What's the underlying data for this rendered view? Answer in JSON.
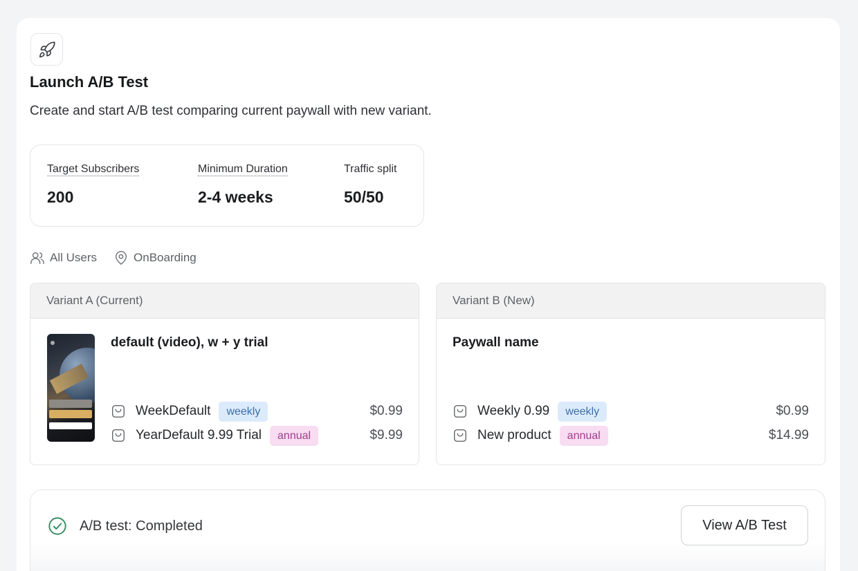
{
  "header": {
    "icon": "rocket-icon",
    "title": "Launch A/B Test",
    "subtitle": "Create and start A/B test comparing current paywall with new variant."
  },
  "stats": [
    {
      "label": "Target Subscribers",
      "value": "200"
    },
    {
      "label": "Minimum Duration",
      "value": "2-4 weeks"
    },
    {
      "label": "Traffic split",
      "value": "50/50"
    }
  ],
  "audience": {
    "users": "All Users",
    "placement": "OnBoarding"
  },
  "variants": [
    {
      "header": "Variant A (Current)",
      "name": "default (video), w + y trial",
      "products": [
        {
          "name": "WeekDefault",
          "badge": "weekly",
          "price": "$0.99"
        },
        {
          "name": "YearDefault 9.99 Trial",
          "badge": "annual",
          "price": "$9.99"
        }
      ]
    },
    {
      "header": "Variant B (New)",
      "name": "Paywall name",
      "products": [
        {
          "name": "Weekly 0.99",
          "badge": "weekly",
          "price": "$0.99"
        },
        {
          "name": "New product",
          "badge": "annual",
          "price": "$14.99"
        }
      ]
    }
  ],
  "status": {
    "text": "A/B test: Completed",
    "button": "View A/B Test"
  },
  "colors": {
    "weekly_badge": "#dcebfb",
    "annual_badge": "#f8dcf2",
    "success": "#2e8a5c"
  }
}
